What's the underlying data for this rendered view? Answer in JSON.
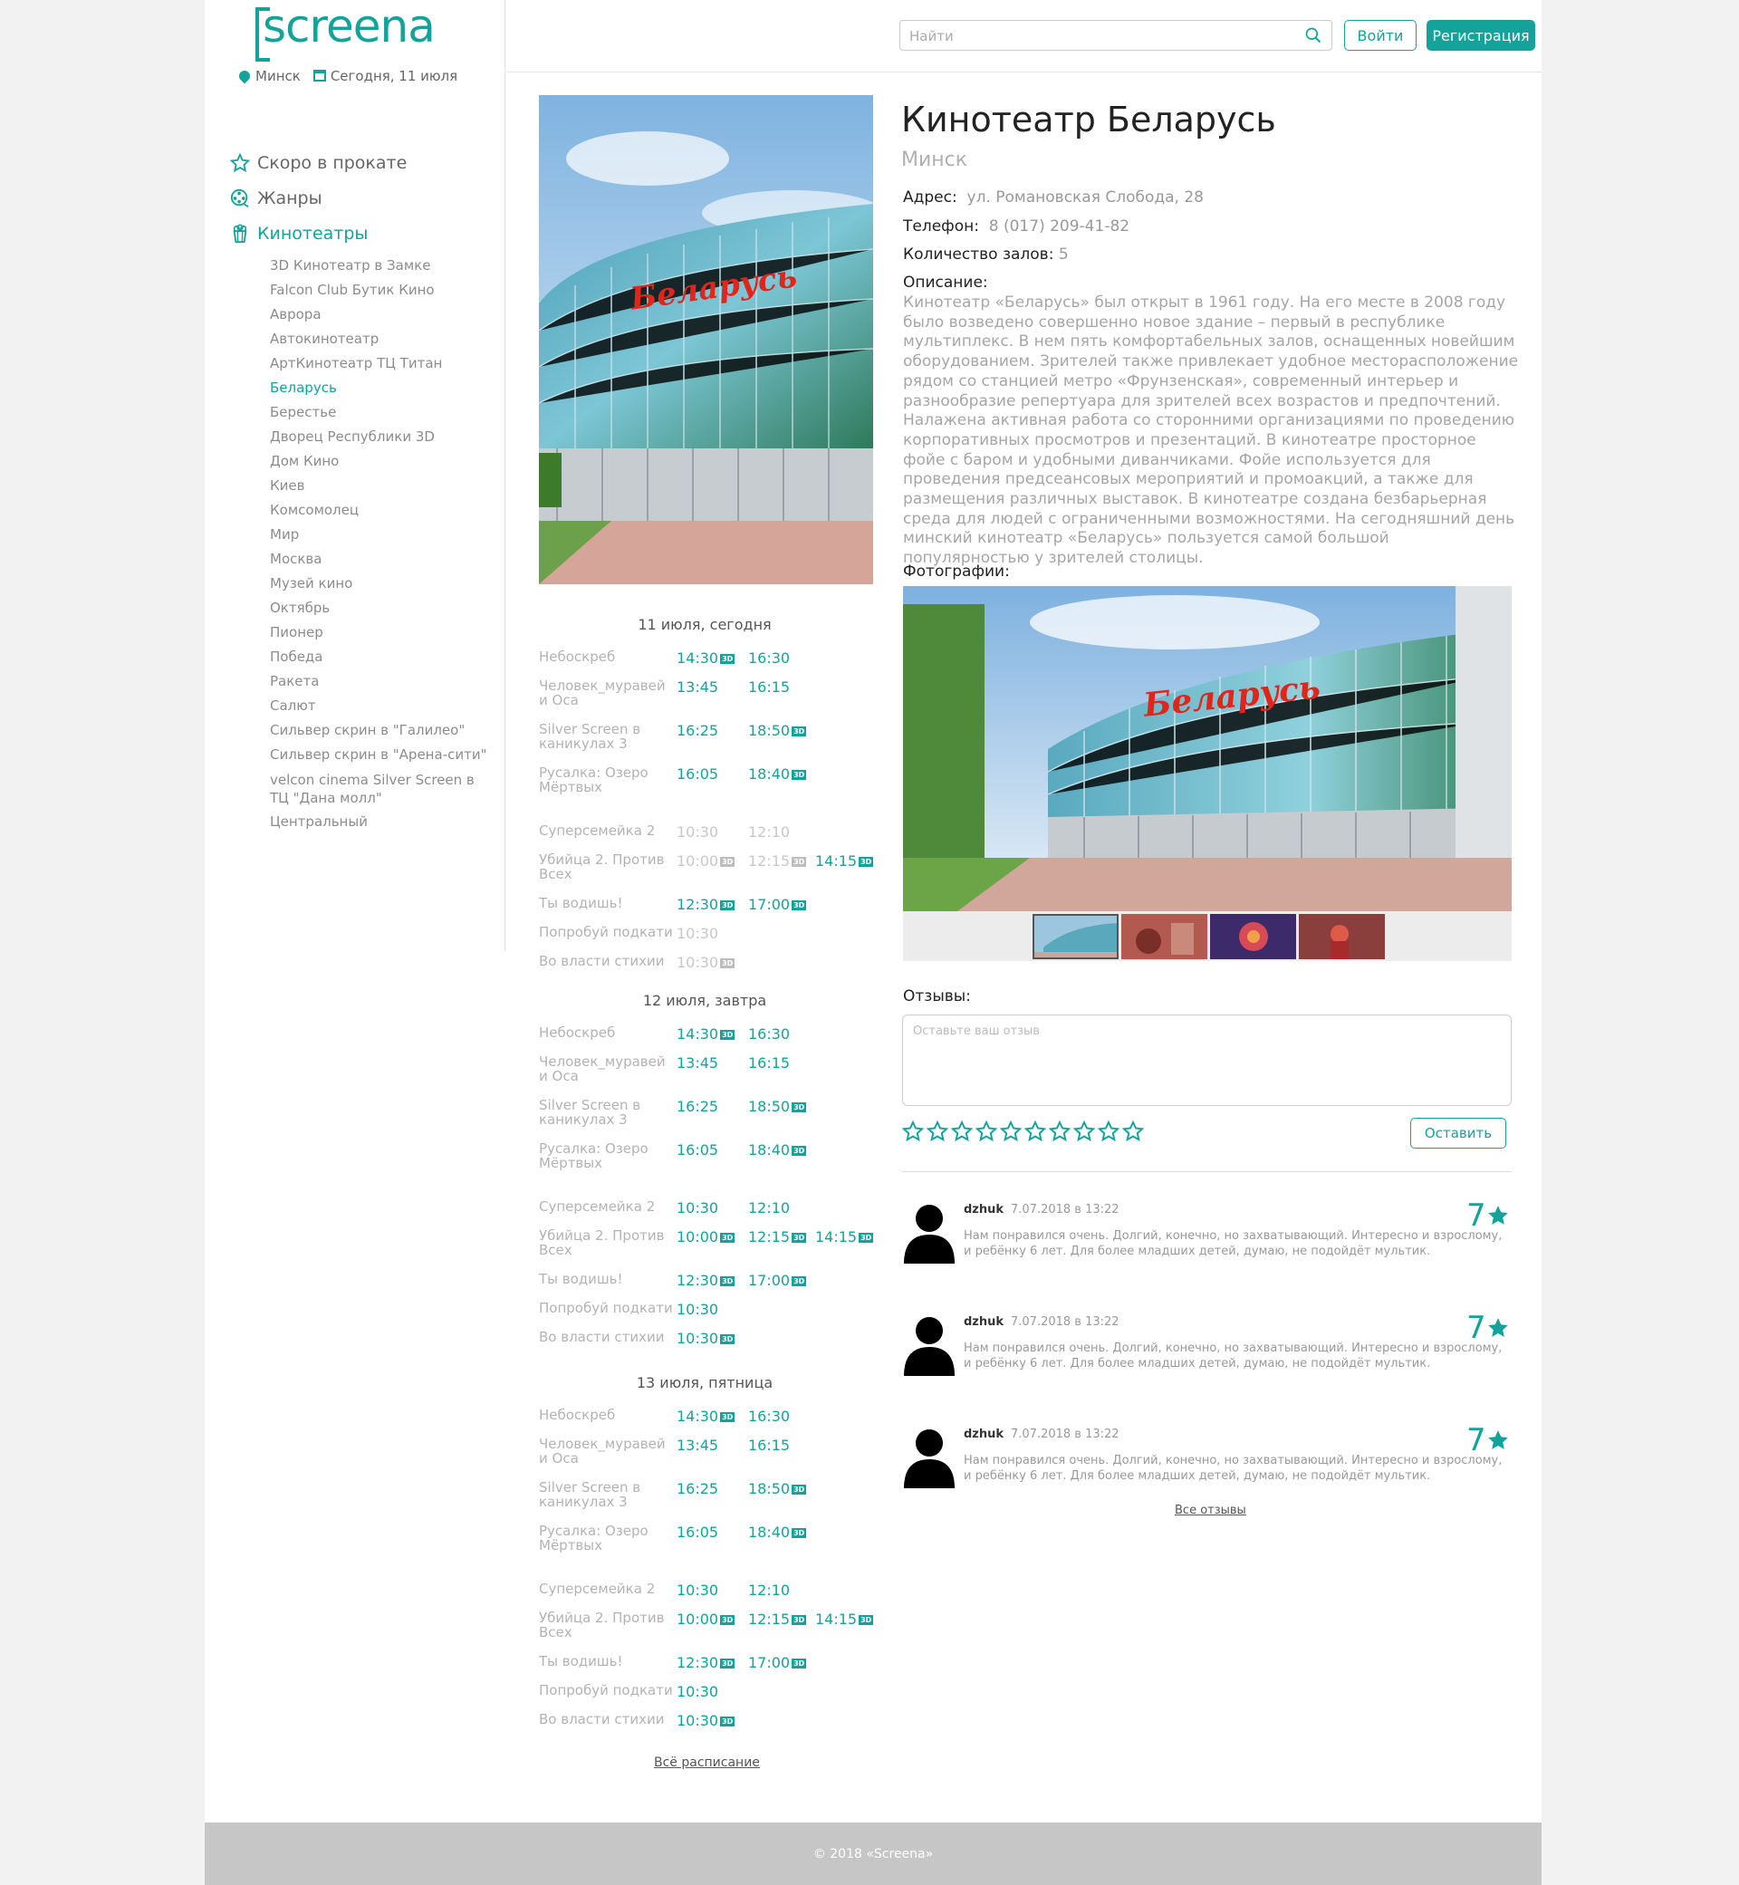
{
  "logo": {
    "text": "screena"
  },
  "location": {
    "city": "Минск",
    "date": "Сегодня, 11 июля"
  },
  "menu": [
    {
      "label": "Скоро в прокате",
      "icon": "star-icon"
    },
    {
      "label": "Жанры",
      "icon": "film-reel-icon"
    },
    {
      "label": "Кинотеатры",
      "icon": "popcorn-icon",
      "active": true
    }
  ],
  "cinemas": [
    "3D Кинотеатр в Замке",
    "Falcon Club Бутик Кино",
    "Аврора",
    "Автокинотеатр",
    "АртКинотеатр ТЦ Титан",
    "Беларусь",
    "Берестье",
    "Дворец Республики 3D",
    "Дом Кино",
    "Киев",
    "Комсомолец",
    "Мир",
    "Москва",
    "Музей кино",
    "Октябрь",
    "Пионер",
    "Победа",
    "Ракета",
    "Салют",
    "Сильвер скрин в \"Галилео\"",
    "Сильвер скрин в \"Арена-сити\"",
    "velcon cinema Silver Screen в ТЦ \"Дана молл\"",
    "Центральный"
  ],
  "cinemas_active": "Беларусь",
  "header": {
    "search_placeholder": "Найти",
    "login": "Войти",
    "register": "Регистрация"
  },
  "cinema": {
    "title": "Кинотеатр Беларусь",
    "city": "Минск",
    "address_label": "Адрес:",
    "address": "ул. Романовская Слобода, 28",
    "phone_label": "Телефон:",
    "phone": "8 (017) 209-41-82",
    "halls_label": "Количество залов:",
    "halls": "5",
    "desc_label": "Описание:",
    "description": "Кинотеатр «Беларусь» был открыт в 1961 году. На его месте в 2008 году было возведено совершенно новое здание – первый в республике мультиплекс. В нем пять комфортабельных залов, оснащенных новейшим оборудованием. Зрителей также привлекает удобное месторасположение рядом со станцией метро «Фрунзенская», современный интерьер и разнообразие репертуара для зрителей всех возрастов и предпочтений. Налажена активная работа со сторонними организациями по проведению корпоративных просмотров и презентаций. В кинотеатре просторное фойе с баром и удобными диванчиками. Фойе используется для проведения предсеансовых мероприятий и промоакций, а также для размещения различных выставок. В кинотеатре создана безбарьерная среда для людей с ограниченными возможностями. На сегодняшний день минский кинотеатр «Беларусь» пользуется самой большой популярностью у зрителей столицы.",
    "sign": "Беларусь",
    "photos_label": "Фотографии:"
  },
  "badge_3d": "3D",
  "schedule": [
    {
      "title": "11 июля, сегодня",
      "rows": [
        {
          "name": "Небоскреб",
          "times": [
            {
              "t": "14:30",
              "d3": true
            },
            {
              "t": "16:30"
            }
          ]
        },
        {
          "name": "Человек_муравей и Оса",
          "times": [
            {
              "t": "13:45"
            },
            {
              "t": "16:15"
            }
          ]
        },
        {
          "name": "Silver Screen в каникулах 3",
          "times": [
            {
              "t": "16:25"
            },
            {
              "t": "18:50",
              "d3": true
            }
          ]
        },
        {
          "name": "Русалка: Озеро Мёртвых",
          "times": [
            {
              "t": "16:05"
            },
            {
              "t": "18:40",
              "d3": true
            }
          ]
        },
        {
          "name": "Суперсемейка 2",
          "times": [
            {
              "t": "10:30",
              "dim": true
            },
            {
              "t": "12:10",
              "dim": true
            }
          ]
        },
        {
          "name": "Убийца 2. Против Всех",
          "times": [
            {
              "t": "10:00",
              "d3": true,
              "dim": true
            },
            {
              "t": "12:15",
              "d3": true,
              "dim": true
            },
            {
              "t": "14:15",
              "d3": true
            }
          ]
        },
        {
          "name": "Ты водишь!",
          "times": [
            {
              "t": "12:30",
              "d3": true
            },
            {
              "t": "17:00",
              "d3": true
            }
          ]
        },
        {
          "name": "Попробуй подкати",
          "times": [
            {
              "t": "10:30",
              "dim": true
            }
          ]
        },
        {
          "name": "Во власти стихии",
          "times": [
            {
              "t": "10:30",
              "d3": true,
              "dim": true
            }
          ]
        }
      ]
    },
    {
      "title": "12 июля, завтра",
      "rows": [
        {
          "name": "Небоскреб",
          "times": [
            {
              "t": "14:30",
              "d3": true
            },
            {
              "t": "16:30"
            }
          ]
        },
        {
          "name": "Человек_муравей и Оса",
          "times": [
            {
              "t": "13:45"
            },
            {
              "t": "16:15"
            }
          ]
        },
        {
          "name": "Silver Screen в каникулах 3",
          "times": [
            {
              "t": "16:25"
            },
            {
              "t": "18:50",
              "d3": true
            }
          ]
        },
        {
          "name": "Русалка: Озеро Мёртвых",
          "times": [
            {
              "t": "16:05"
            },
            {
              "t": "18:40",
              "d3": true
            }
          ]
        },
        {
          "name": "Суперсемейка 2",
          "times": [
            {
              "t": "10:30"
            },
            {
              "t": "12:10"
            }
          ]
        },
        {
          "name": "Убийца 2. Против Всех",
          "times": [
            {
              "t": "10:00",
              "d3": true
            },
            {
              "t": "12:15",
              "d3": true
            },
            {
              "t": "14:15",
              "d3": true
            }
          ]
        },
        {
          "name": "Ты водишь!",
          "times": [
            {
              "t": "12:30",
              "d3": true
            },
            {
              "t": "17:00",
              "d3": true
            }
          ]
        },
        {
          "name": "Попробуй подкати",
          "times": [
            {
              "t": "10:30"
            }
          ]
        },
        {
          "name": "Во власти стихии",
          "times": [
            {
              "t": "10:30",
              "d3": true
            }
          ]
        }
      ]
    },
    {
      "title": "13 июля, пятница",
      "rows": [
        {
          "name": "Небоскреб",
          "times": [
            {
              "t": "14:30",
              "d3": true
            },
            {
              "t": "16:30"
            }
          ]
        },
        {
          "name": "Человек_муравей и Оса",
          "times": [
            {
              "t": "13:45"
            },
            {
              "t": "16:15"
            }
          ]
        },
        {
          "name": "Silver Screen в каникулах 3",
          "times": [
            {
              "t": "16:25"
            },
            {
              "t": "18:50",
              "d3": true
            }
          ]
        },
        {
          "name": "Русалка: Озеро Мёртвых",
          "times": [
            {
              "t": "16:05"
            },
            {
              "t": "18:40",
              "d3": true
            }
          ]
        },
        {
          "name": "Суперсемейка 2",
          "times": [
            {
              "t": "10:30"
            },
            {
              "t": "12:10"
            }
          ]
        },
        {
          "name": "Убийца 2. Против Всех",
          "times": [
            {
              "t": "10:00",
              "d3": true
            },
            {
              "t": "12:15",
              "d3": true
            },
            {
              "t": "14:15",
              "d3": true
            }
          ]
        },
        {
          "name": "Ты водишь!",
          "times": [
            {
              "t": "12:30",
              "d3": true
            },
            {
              "t": "17:00",
              "d3": true
            }
          ]
        },
        {
          "name": "Попробуй подкати",
          "times": [
            {
              "t": "10:30"
            }
          ]
        },
        {
          "name": "Во власти стихии",
          "times": [
            {
              "t": "10:30",
              "d3": true
            }
          ]
        }
      ]
    }
  ],
  "all_schedule_link": "Всё расписание",
  "reviews": {
    "label": "Отзывы:",
    "placeholder": "Оставьте ваш отзыв",
    "submit": "Оставить",
    "rating_stars_count": 10,
    "items": [
      {
        "author": "dzhuk",
        "date": "7.07.2018 в 13:22",
        "text": "Нам понравился очень. Долгий, конечно, но захватывающий. Интересно и взрослому, и ребёнку 6 лет. Для более младших детей, думаю, не подойдёт мультик.",
        "score": "7"
      },
      {
        "author": "dzhuk",
        "date": "7.07.2018 в 13:22",
        "text": "Нам понравился очень. Долгий, конечно, но захватывающий. Интересно и взрослому, и ребёнку 6 лет. Для более младших детей, думаю, не подойдёт мультик.",
        "score": "7"
      },
      {
        "author": "dzhuk",
        "date": "7.07.2018 в 13:22",
        "text": "Нам понравился очень. Долгий, конечно, но захватывающий. Интересно и взрослому, и ребёнку 6 лет. Для более младших детей, думаю, не подойдёт мультик.",
        "score": "7"
      }
    ],
    "all_link": "Все отзывы"
  },
  "footer": {
    "copyright": "© 2018 «Screena»"
  },
  "colors": {
    "accent": "#14a39a",
    "footer": "#c6c6c6",
    "sign_red": "#e0261b"
  }
}
